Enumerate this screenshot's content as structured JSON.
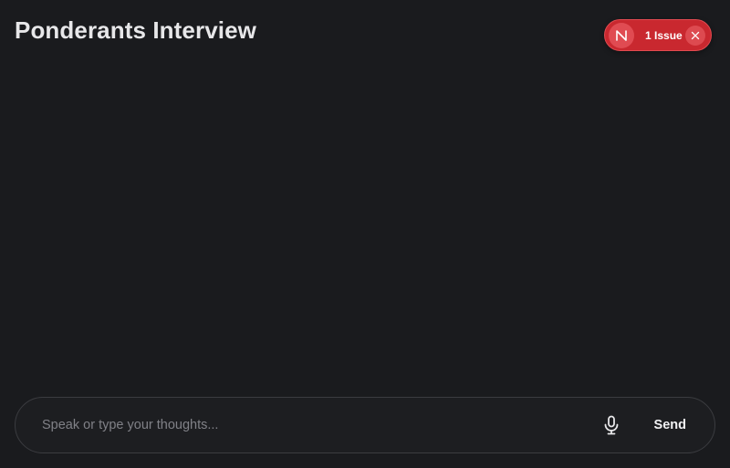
{
  "header": {
    "title": "Ponderants Interview"
  },
  "dev_overlay": {
    "badge_letter_icon": "nextjs-n-icon",
    "issues_label": "1 Issue",
    "close_icon": "close-icon",
    "accent_color": "#c9282f"
  },
  "composer": {
    "placeholder": "Speak or type your thoughts...",
    "value": "",
    "mic_icon": "microphone-icon",
    "send_label": "Send"
  },
  "theme": {
    "background": "#1a1b1e",
    "text": "#e7e7e9",
    "border": "#3b3c40"
  }
}
